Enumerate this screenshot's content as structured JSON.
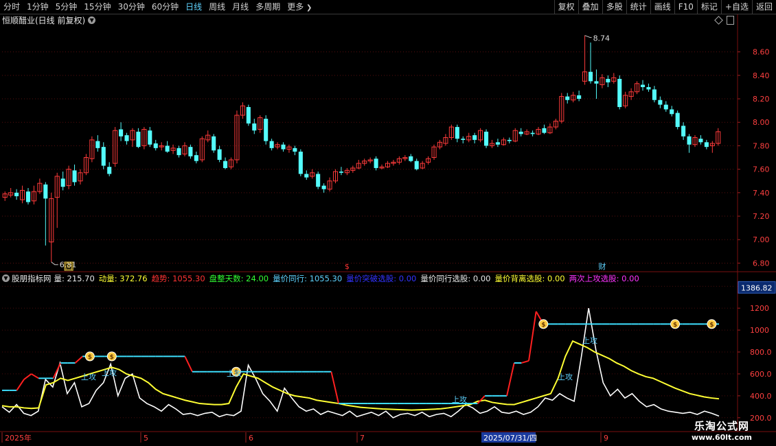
{
  "timeframe_tabs": [
    {
      "label": "分时",
      "active": false
    },
    {
      "label": "1分钟",
      "active": false
    },
    {
      "label": "5分钟",
      "active": false
    },
    {
      "label": "15分钟",
      "active": false
    },
    {
      "label": "30分钟",
      "active": false
    },
    {
      "label": "60分钟",
      "active": false
    },
    {
      "label": "日线",
      "active": true
    },
    {
      "label": "周线",
      "active": false
    },
    {
      "label": "月线",
      "active": false
    },
    {
      "label": "多周期",
      "active": false
    }
  ],
  "more_label": "更多",
  "toolbar": [
    "复权",
    "叠加",
    "多股",
    "统计",
    "画线",
    "F10",
    "标记",
    "+自选",
    "返回"
  ],
  "stock_title": "恒顺醋业(日线 前复权)",
  "price_axis": [
    "8.60",
    "8.40",
    "8.20",
    "8.00",
    "7.80",
    "7.60",
    "7.40",
    "7.20",
    "7.00",
    "6.80"
  ],
  "price_high_label": "8.74",
  "price_low_label": "6.81",
  "event_markers": [
    {
      "text": "回",
      "color": "#ffd84a"
    },
    {
      "text": "$",
      "color": "#ff3333"
    },
    {
      "text": "财",
      "color": "#5fd3ff"
    }
  ],
  "indicator": {
    "name": "股朋指标网",
    "fields": [
      {
        "label": "量: 215.70",
        "color": "#e8e8e8"
      },
      {
        "label": "动量: 372.76",
        "color": "#ffff33"
      },
      {
        "label": "趋势: 1055.30",
        "color": "#ff3333"
      },
      {
        "label": "盘整天数: 24.00",
        "color": "#33ff33"
      },
      {
        "label": "量价同行: 1055.30",
        "color": "#5fd3ff"
      },
      {
        "label": "量价突破选股: 0.00",
        "color": "#3333ff"
      },
      {
        "label": "量价同行选股: 0.00",
        "color": "#e8e8e8"
      },
      {
        "label": "量价背离选股: 0.00",
        "color": "#ffff33"
      },
      {
        "label": "两次上攻选股: 0.00",
        "color": "#ff33ff"
      }
    ]
  },
  "indicator_axis_current": "1386.82",
  "indicator_axis": [
    "1400",
    "1200",
    "1000",
    "800.0",
    "600.0",
    "400.0",
    "200.0"
  ],
  "attack_label": "上攻",
  "date_axis": [
    "2025年",
    "5",
    "6",
    "7",
    "9"
  ],
  "date_cursor": "2025/07/31/四",
  "logo": {
    "line1": "乐淘公式网",
    "line2": "www.60lt.com"
  },
  "colors": {
    "up": "#ff3b3b",
    "down": "#54fcfc",
    "ma_yellow": "#ffff33",
    "cyan": "#3ee0ff",
    "red": "#ff2020",
    "white": "#ffffff"
  },
  "chart_data": [
    {
      "type": "candlestick",
      "title": "恒顺醋业(日线 前复权)",
      "ylim": [
        6.75,
        8.82
      ],
      "candles": [
        [
          7.36,
          7.39,
          7.41,
          7.33
        ],
        [
          7.38,
          7.4,
          7.44,
          7.36
        ],
        [
          7.4,
          7.37,
          7.43,
          7.34
        ],
        [
          7.34,
          7.42,
          7.46,
          7.31
        ],
        [
          7.41,
          7.32,
          7.44,
          7.3
        ],
        [
          7.33,
          7.41,
          7.46,
          7.3
        ],
        [
          7.41,
          7.48,
          7.52,
          7.39
        ],
        [
          7.47,
          7.35,
          7.49,
          6.95
        ],
        [
          6.98,
          7.35,
          7.4,
          6.81
        ],
        [
          7.36,
          7.54,
          7.57,
          7.1
        ],
        [
          7.52,
          7.45,
          7.58,
          7.42
        ],
        [
          7.46,
          7.6,
          7.63,
          7.43
        ],
        [
          7.59,
          7.49,
          7.64,
          7.46
        ],
        [
          7.5,
          7.57,
          7.6,
          7.47
        ],
        [
          7.57,
          7.7,
          7.73,
          7.55
        ],
        [
          7.69,
          7.85,
          7.88,
          7.66
        ],
        [
          7.84,
          7.78,
          7.89,
          7.75
        ],
        [
          7.79,
          7.63,
          7.83,
          7.6
        ],
        [
          7.62,
          7.56,
          7.66,
          7.54
        ],
        [
          7.65,
          7.93,
          7.96,
          7.62
        ],
        [
          7.94,
          7.88,
          8.0,
          7.84
        ],
        [
          7.89,
          7.84,
          7.91,
          7.81
        ],
        [
          7.85,
          7.93,
          7.95,
          7.79
        ],
        [
          7.92,
          7.79,
          7.95,
          7.78
        ],
        [
          7.8,
          7.94,
          7.96,
          7.77
        ],
        [
          7.93,
          7.81,
          7.96,
          7.79
        ],
        [
          7.82,
          7.78,
          7.85,
          7.76
        ],
        [
          7.79,
          7.8,
          7.83,
          7.76
        ],
        [
          7.8,
          7.75,
          7.84,
          7.74
        ],
        [
          7.76,
          7.78,
          7.81,
          7.73
        ],
        [
          7.78,
          7.72,
          7.8,
          7.7
        ],
        [
          7.73,
          7.8,
          7.83,
          7.71
        ],
        [
          7.79,
          7.71,
          7.81,
          7.69
        ],
        [
          7.72,
          7.67,
          7.75,
          7.65
        ],
        [
          7.68,
          7.86,
          7.88,
          7.66
        ],
        [
          7.85,
          7.89,
          7.93,
          7.83
        ],
        [
          7.88,
          7.76,
          7.9,
          7.74
        ],
        [
          7.77,
          7.68,
          7.8,
          7.66
        ],
        [
          7.67,
          7.61,
          7.7,
          7.6
        ],
        [
          7.62,
          7.68,
          7.7,
          7.6
        ],
        [
          7.68,
          8.06,
          8.1,
          7.65
        ],
        [
          8.06,
          8.14,
          8.17,
          8.03
        ],
        [
          8.13,
          7.99,
          8.15,
          7.97
        ],
        [
          7.99,
          7.93,
          8.03,
          7.9
        ],
        [
          7.94,
          8.04,
          8.06,
          7.91
        ],
        [
          8.03,
          7.84,
          8.06,
          7.81
        ],
        [
          7.84,
          7.78,
          7.86,
          7.76
        ],
        [
          7.79,
          7.81,
          7.83,
          7.77
        ],
        [
          7.81,
          7.77,
          7.83,
          7.75
        ],
        [
          7.77,
          7.79,
          7.81,
          7.74
        ],
        [
          7.78,
          7.75,
          7.8,
          7.72
        ],
        [
          7.75,
          7.56,
          7.77,
          7.54
        ],
        [
          7.56,
          7.53,
          7.59,
          7.51
        ],
        [
          7.54,
          7.57,
          7.6,
          7.52
        ],
        [
          7.56,
          7.45,
          7.58,
          7.43
        ],
        [
          7.46,
          7.43,
          7.48,
          7.4
        ],
        [
          7.43,
          7.5,
          7.53,
          7.41
        ],
        [
          7.5,
          7.58,
          7.6,
          7.48
        ],
        [
          7.58,
          7.57,
          7.62,
          7.55
        ],
        [
          7.57,
          7.59,
          7.61,
          7.55
        ],
        [
          7.59,
          7.61,
          7.63,
          7.57
        ],
        [
          7.61,
          7.65,
          7.68,
          7.6
        ],
        [
          7.65,
          7.67,
          7.69,
          7.63
        ],
        [
          7.67,
          7.68,
          7.7,
          7.65
        ],
        [
          7.69,
          7.61,
          7.71,
          7.59
        ],
        [
          7.61,
          7.62,
          7.64,
          7.6
        ],
        [
          7.62,
          7.65,
          7.67,
          7.61
        ],
        [
          7.65,
          7.66,
          7.68,
          7.63
        ],
        [
          7.66,
          7.69,
          7.71,
          7.64
        ],
        [
          7.69,
          7.7,
          7.72,
          7.67
        ],
        [
          7.71,
          7.67,
          7.73,
          7.66
        ],
        [
          7.67,
          7.6,
          7.69,
          7.59
        ],
        [
          7.61,
          7.65,
          7.67,
          7.6
        ],
        [
          7.66,
          7.69,
          7.71,
          7.64
        ],
        [
          7.7,
          7.79,
          7.81,
          7.68
        ],
        [
          7.79,
          7.83,
          7.85,
          7.77
        ],
        [
          7.82,
          7.87,
          7.9,
          7.8
        ],
        [
          7.87,
          7.96,
          7.98,
          7.85
        ],
        [
          7.96,
          7.86,
          7.98,
          7.83
        ],
        [
          7.86,
          7.85,
          7.88,
          7.82
        ],
        [
          7.85,
          7.88,
          7.91,
          7.83
        ],
        [
          7.89,
          7.85,
          7.91,
          7.82
        ],
        [
          7.85,
          7.93,
          7.95,
          7.83
        ],
        [
          7.92,
          7.8,
          7.94,
          7.78
        ],
        [
          7.8,
          7.82,
          7.85,
          7.78
        ],
        [
          7.83,
          7.81,
          7.86,
          7.79
        ],
        [
          7.81,
          7.85,
          7.87,
          7.8
        ],
        [
          7.85,
          7.84,
          7.87,
          7.82
        ],
        [
          7.84,
          7.93,
          7.95,
          7.83
        ],
        [
          7.92,
          7.9,
          7.95,
          7.88
        ],
        [
          7.9,
          7.92,
          7.94,
          7.89
        ],
        [
          7.91,
          7.9,
          7.93,
          7.88
        ],
        [
          7.9,
          7.94,
          7.96,
          7.89
        ],
        [
          7.95,
          7.91,
          7.98,
          7.9
        ],
        [
          7.91,
          7.96,
          7.99,
          7.9
        ],
        [
          7.96,
          8.01,
          8.03,
          7.94
        ],
        [
          8.01,
          8.22,
          8.25,
          7.99
        ],
        [
          8.22,
          8.19,
          8.25,
          8.16
        ],
        [
          8.19,
          8.23,
          8.26,
          8.17
        ],
        [
          8.23,
          8.2,
          8.27,
          8.18
        ],
        [
          8.35,
          8.43,
          8.74,
          8.32
        ],
        [
          8.43,
          8.35,
          8.68,
          8.33
        ],
        [
          8.35,
          8.33,
          8.45,
          8.2
        ],
        [
          8.32,
          8.38,
          8.41,
          8.29
        ],
        [
          8.37,
          8.34,
          8.4,
          8.3
        ],
        [
          8.35,
          8.38,
          8.42,
          8.33
        ],
        [
          8.37,
          8.13,
          8.4,
          8.11
        ],
        [
          8.14,
          8.23,
          8.26,
          8.12
        ],
        [
          8.22,
          8.26,
          8.29,
          8.19
        ],
        [
          8.26,
          8.33,
          8.35,
          8.24
        ],
        [
          8.32,
          8.3,
          8.36,
          8.27
        ],
        [
          8.3,
          8.28,
          8.33,
          8.26
        ],
        [
          8.28,
          8.19,
          8.31,
          8.17
        ],
        [
          8.19,
          8.15,
          8.22,
          8.12
        ],
        [
          8.15,
          8.11,
          8.18,
          8.09
        ],
        [
          8.11,
          8.07,
          8.14,
          8.05
        ],
        [
          8.08,
          7.96,
          8.1,
          7.94
        ],
        [
          7.97,
          7.88,
          8.0,
          7.85
        ],
        [
          7.88,
          7.81,
          7.9,
          7.74
        ],
        [
          7.81,
          7.87,
          7.89,
          7.79
        ],
        [
          7.86,
          7.83,
          7.89,
          7.81
        ],
        [
          7.83,
          7.79,
          7.85,
          7.77
        ],
        [
          7.8,
          7.82,
          7.84,
          7.74
        ],
        [
          7.82,
          7.92,
          7.95,
          7.8
        ]
      ]
    },
    {
      "type": "line",
      "title": "股朋指标网",
      "ylim": [
        180,
        1420
      ],
      "series": [
        {
          "name": "量",
          "color": "#ffffff",
          "values": [
            300,
            250,
            320,
            240,
            220,
            260,
            550,
            480,
            700,
            420,
            520,
            300,
            330,
            450,
            520,
            690,
            400,
            560,
            600,
            380,
            330,
            300,
            260,
            320,
            280,
            230,
            240,
            220,
            240,
            250,
            210,
            230,
            220,
            260,
            680,
            560,
            420,
            350,
            260,
            470,
            380,
            300,
            260,
            280,
            230,
            260,
            240,
            220,
            260,
            210,
            230,
            250,
            220,
            260,
            200,
            230,
            240,
            220,
            250,
            210,
            230,
            240,
            210,
            260,
            320,
            290,
            240,
            260,
            300,
            250,
            240,
            260,
            230,
            250,
            300,
            380,
            360,
            420,
            380,
            350,
            760,
            1200,
            820,
            520,
            400,
            460,
            380,
            420,
            350,
            300,
            320,
            280,
            260,
            250,
            240,
            250,
            230,
            260,
            240,
            215
          ]
        },
        {
          "name": "动量",
          "color": "#ffff33",
          "values": [
            310,
            300,
            300,
            290,
            285,
            290,
            500,
            520,
            560,
            540,
            560,
            580,
            600,
            620,
            640,
            660,
            640,
            600,
            580,
            560,
            520,
            460,
            420,
            400,
            380,
            360,
            345,
            330,
            325,
            320,
            320,
            330,
            480,
            600,
            580,
            560,
            520,
            480,
            450,
            420,
            400,
            390,
            380,
            360,
            350,
            340,
            330,
            315,
            305,
            295,
            290,
            285,
            280,
            278,
            275,
            272,
            270,
            272,
            275,
            278,
            282,
            290,
            300,
            310,
            320,
            350,
            360,
            340,
            330,
            322,
            320,
            340,
            360,
            380,
            400,
            420,
            560,
            760,
            900,
            870,
            840,
            800,
            770,
            740,
            700,
            670,
            630,
            600,
            575,
            560,
            530,
            500,
            470,
            445,
            420,
            405,
            390,
            380,
            373
          ]
        },
        {
          "name": "趋势",
          "color": "#ff2020",
          "values": [
            450,
            450,
            450,
            550,
            600,
            560,
            560,
            560,
            700,
            700,
            700,
            760,
            760,
            760,
            760,
            760,
            760,
            760,
            760,
            760,
            760,
            760,
            760,
            760,
            760,
            760,
            620,
            620,
            620,
            620,
            620,
            620,
            620,
            620,
            620,
            620,
            620,
            620,
            620,
            620,
            620,
            620,
            620,
            620,
            620,
            620,
            330,
            330,
            330,
            330,
            330,
            330,
            330,
            330,
            330,
            330,
            330,
            330,
            330,
            330,
            330,
            330,
            330,
            330,
            330,
            330,
            400,
            400,
            400,
            400,
            700,
            700,
            720,
            1170,
            1055,
            1055,
            1055,
            1055,
            1055,
            1055,
            1055,
            1055,
            1055,
            1055,
            1055,
            1055,
            1055,
            1055,
            1055,
            1055,
            1055,
            1055,
            1055,
            1055,
            1055,
            1055,
            1055,
            1055,
            1055
          ]
        }
      ]
    }
  ]
}
